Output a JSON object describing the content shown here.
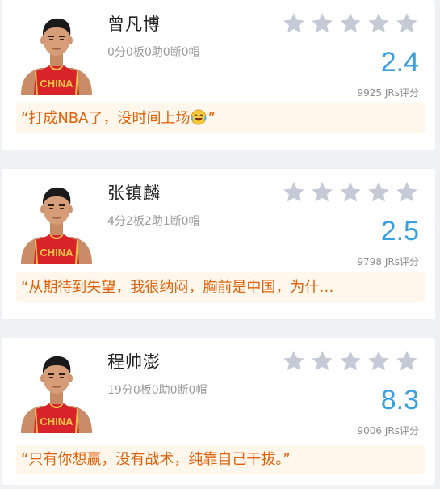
{
  "players": [
    {
      "name": "曾凡博",
      "stats": "0分0板0助0断0帽",
      "rating": "2.4",
      "votes": "9925 JRs评分",
      "comment_prefix": "“打成NBA了，没时间上场",
      "comment_suffix": "”",
      "comment_emoji": "crying-laughing-emoji",
      "jersey_text": "CHINA",
      "stars_filled": 0,
      "stars_total": 5
    },
    {
      "name": "张镇麟",
      "stats": "4分2板2助1断0帽",
      "rating": "2.5",
      "votes": "9798 JRs评分",
      "comment_prefix": "“从期待到失望，我很纳闷，胸前是中国，为什…",
      "comment_suffix": "",
      "comment_emoji": "",
      "jersey_text": "CHINA",
      "stars_filled": 0,
      "stars_total": 5
    },
    {
      "name": "程帅澎",
      "stats": "19分0板0助0断0帽",
      "rating": "8.3",
      "votes": "9006 JRs评分",
      "comment_prefix": "“只有你想赢，没有战术，纯靠自己干拔。”",
      "comment_suffix": "",
      "comment_emoji": "",
      "jersey_text": "CHINA",
      "stars_filled": 0,
      "stars_total": 5
    }
  ],
  "colors": {
    "background": "#f0f1f5",
    "card": "#ffffff",
    "score": "#3aa0e0",
    "star_empty": "#c5cad6",
    "comment_bg": "#fff6ec",
    "comment_text": "#e0620a",
    "jersey_red": "#d8232a",
    "jersey_gold": "#f6c24a"
  },
  "icons": {
    "star": "star-icon",
    "avatar": "player-avatar"
  }
}
